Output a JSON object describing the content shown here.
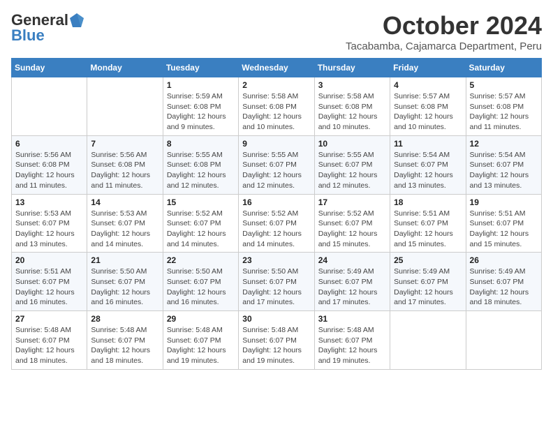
{
  "header": {
    "logo_general": "General",
    "logo_blue": "Blue",
    "title": "October 2024",
    "location": "Tacabamba, Cajamarca Department, Peru"
  },
  "weekdays": [
    "Sunday",
    "Monday",
    "Tuesday",
    "Wednesday",
    "Thursday",
    "Friday",
    "Saturday"
  ],
  "weeks": [
    [
      {
        "day": "",
        "detail": ""
      },
      {
        "day": "",
        "detail": ""
      },
      {
        "day": "1",
        "detail": "Sunrise: 5:59 AM\nSunset: 6:08 PM\nDaylight: 12 hours and 9 minutes."
      },
      {
        "day": "2",
        "detail": "Sunrise: 5:58 AM\nSunset: 6:08 PM\nDaylight: 12 hours and 10 minutes."
      },
      {
        "day": "3",
        "detail": "Sunrise: 5:58 AM\nSunset: 6:08 PM\nDaylight: 12 hours and 10 minutes."
      },
      {
        "day": "4",
        "detail": "Sunrise: 5:57 AM\nSunset: 6:08 PM\nDaylight: 12 hours and 10 minutes."
      },
      {
        "day": "5",
        "detail": "Sunrise: 5:57 AM\nSunset: 6:08 PM\nDaylight: 12 hours and 11 minutes."
      }
    ],
    [
      {
        "day": "6",
        "detail": "Sunrise: 5:56 AM\nSunset: 6:08 PM\nDaylight: 12 hours and 11 minutes."
      },
      {
        "day": "7",
        "detail": "Sunrise: 5:56 AM\nSunset: 6:08 PM\nDaylight: 12 hours and 11 minutes."
      },
      {
        "day": "8",
        "detail": "Sunrise: 5:55 AM\nSunset: 6:08 PM\nDaylight: 12 hours and 12 minutes."
      },
      {
        "day": "9",
        "detail": "Sunrise: 5:55 AM\nSunset: 6:07 PM\nDaylight: 12 hours and 12 minutes."
      },
      {
        "day": "10",
        "detail": "Sunrise: 5:55 AM\nSunset: 6:07 PM\nDaylight: 12 hours and 12 minutes."
      },
      {
        "day": "11",
        "detail": "Sunrise: 5:54 AM\nSunset: 6:07 PM\nDaylight: 12 hours and 13 minutes."
      },
      {
        "day": "12",
        "detail": "Sunrise: 5:54 AM\nSunset: 6:07 PM\nDaylight: 12 hours and 13 minutes."
      }
    ],
    [
      {
        "day": "13",
        "detail": "Sunrise: 5:53 AM\nSunset: 6:07 PM\nDaylight: 12 hours and 13 minutes."
      },
      {
        "day": "14",
        "detail": "Sunrise: 5:53 AM\nSunset: 6:07 PM\nDaylight: 12 hours and 14 minutes."
      },
      {
        "day": "15",
        "detail": "Sunrise: 5:52 AM\nSunset: 6:07 PM\nDaylight: 12 hours and 14 minutes."
      },
      {
        "day": "16",
        "detail": "Sunrise: 5:52 AM\nSunset: 6:07 PM\nDaylight: 12 hours and 14 minutes."
      },
      {
        "day": "17",
        "detail": "Sunrise: 5:52 AM\nSunset: 6:07 PM\nDaylight: 12 hours and 15 minutes."
      },
      {
        "day": "18",
        "detail": "Sunrise: 5:51 AM\nSunset: 6:07 PM\nDaylight: 12 hours and 15 minutes."
      },
      {
        "day": "19",
        "detail": "Sunrise: 5:51 AM\nSunset: 6:07 PM\nDaylight: 12 hours and 15 minutes."
      }
    ],
    [
      {
        "day": "20",
        "detail": "Sunrise: 5:51 AM\nSunset: 6:07 PM\nDaylight: 12 hours and 16 minutes."
      },
      {
        "day": "21",
        "detail": "Sunrise: 5:50 AM\nSunset: 6:07 PM\nDaylight: 12 hours and 16 minutes."
      },
      {
        "day": "22",
        "detail": "Sunrise: 5:50 AM\nSunset: 6:07 PM\nDaylight: 12 hours and 16 minutes."
      },
      {
        "day": "23",
        "detail": "Sunrise: 5:50 AM\nSunset: 6:07 PM\nDaylight: 12 hours and 17 minutes."
      },
      {
        "day": "24",
        "detail": "Sunrise: 5:49 AM\nSunset: 6:07 PM\nDaylight: 12 hours and 17 minutes."
      },
      {
        "day": "25",
        "detail": "Sunrise: 5:49 AM\nSunset: 6:07 PM\nDaylight: 12 hours and 17 minutes."
      },
      {
        "day": "26",
        "detail": "Sunrise: 5:49 AM\nSunset: 6:07 PM\nDaylight: 12 hours and 18 minutes."
      }
    ],
    [
      {
        "day": "27",
        "detail": "Sunrise: 5:48 AM\nSunset: 6:07 PM\nDaylight: 12 hours and 18 minutes."
      },
      {
        "day": "28",
        "detail": "Sunrise: 5:48 AM\nSunset: 6:07 PM\nDaylight: 12 hours and 18 minutes."
      },
      {
        "day": "29",
        "detail": "Sunrise: 5:48 AM\nSunset: 6:07 PM\nDaylight: 12 hours and 19 minutes."
      },
      {
        "day": "30",
        "detail": "Sunrise: 5:48 AM\nSunset: 6:07 PM\nDaylight: 12 hours and 19 minutes."
      },
      {
        "day": "31",
        "detail": "Sunrise: 5:48 AM\nSunset: 6:07 PM\nDaylight: 12 hours and 19 minutes."
      },
      {
        "day": "",
        "detail": ""
      },
      {
        "day": "",
        "detail": ""
      }
    ]
  ]
}
